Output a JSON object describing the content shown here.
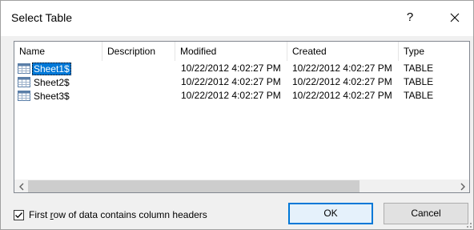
{
  "dialog": {
    "title": "Select Table",
    "help_label": "?",
    "close_icon": "close-icon"
  },
  "list": {
    "columns": [
      "Name",
      "Description",
      "Modified",
      "Created",
      "Type"
    ],
    "rows": [
      {
        "name": "Sheet1$",
        "description": "",
        "modified": "10/22/2012 4:02:27 PM",
        "created": "10/22/2012 4:02:27 PM",
        "type": "TABLE",
        "selected": true
      },
      {
        "name": "Sheet2$",
        "description": "",
        "modified": "10/22/2012 4:02:27 PM",
        "created": "10/22/2012 4:02:27 PM",
        "type": "TABLE",
        "selected": false
      },
      {
        "name": "Sheet3$",
        "description": "",
        "modified": "10/22/2012 4:02:27 PM",
        "created": "10/22/2012 4:02:27 PM",
        "type": "TABLE",
        "selected": false
      }
    ],
    "row_icon": "table-icon",
    "scrollbar": {
      "left_icon": "chevron-left-icon",
      "right_icon": "chevron-right-icon"
    }
  },
  "options": {
    "first_row_headers": {
      "label_pre": "First ",
      "label_access": "r",
      "label_post": "ow of data contains column headers",
      "checked": true
    }
  },
  "buttons": {
    "ok": "OK",
    "cancel": "Cancel"
  },
  "colors": {
    "selection": "#0078d7",
    "default_button_border": "#0078d7"
  }
}
